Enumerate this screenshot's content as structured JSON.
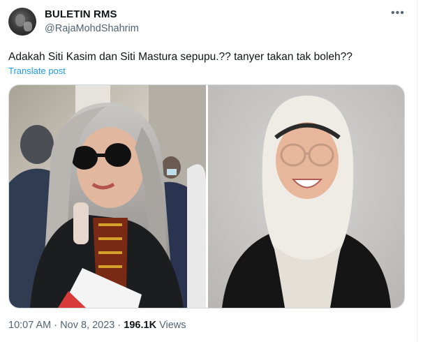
{
  "tweet": {
    "display_name": "BULETIN RMS",
    "handle": "@RajaMohdShahrim",
    "more_label": "•••",
    "text": "Adakah Siti Kasim dan Siti Mastura sepupu.?? tanyer takan tak boleh??",
    "translate_label": "Translate post",
    "time": "10:07 AM",
    "separator": "·",
    "date": "Nov 8, 2023",
    "views_count": "196.1K",
    "views_label": "Views"
  },
  "icons": {
    "more": "more-horizontal-icon"
  },
  "colors": {
    "text": "#0f1419",
    "secondary": "#536471",
    "link": "#1d9bf0",
    "border": "#cfd9de"
  }
}
